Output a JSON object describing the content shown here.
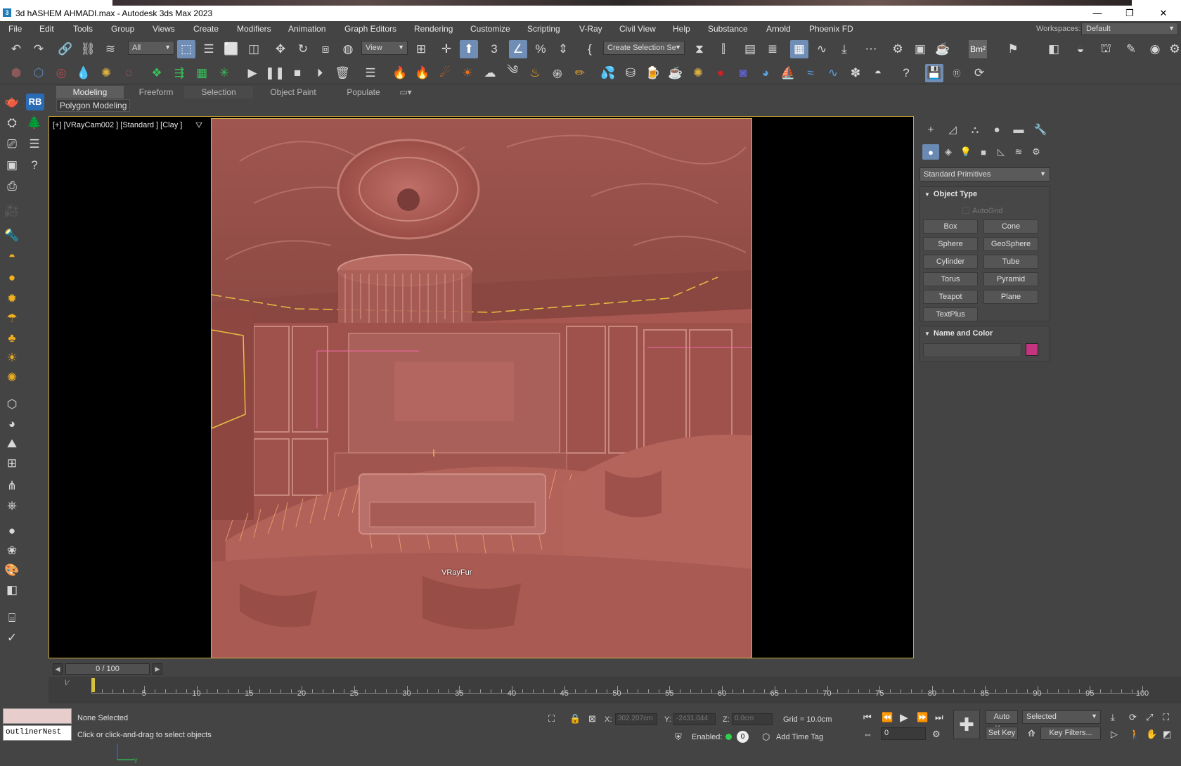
{
  "window": {
    "title": "3d hASHEM AHMADI.max - Autodesk 3ds Max 2023",
    "app_icon": "3",
    "controls": [
      "—",
      "❐",
      "✕"
    ]
  },
  "menu": [
    "File",
    "Edit",
    "Tools",
    "Group",
    "Views",
    "Create",
    "Modifiers",
    "Animation",
    "Graph Editors",
    "Rendering",
    "Customize",
    "Scripting",
    "V-Ray",
    "Civil View",
    "Help",
    "Substance",
    "Arnold",
    "Phoenix FD"
  ],
  "workspaces": {
    "label": "Workspaces:",
    "value": "Default"
  },
  "toolbar": {
    "selection_filter": "All",
    "ref_coord": "View",
    "create_selection_set": "Create Selection Se",
    "snaps_label": "3",
    "bm_label": "Bm²"
  },
  "ribbon": {
    "tabs": [
      "Modeling",
      "Freeform",
      "Selection",
      "Object Paint",
      "Populate"
    ],
    "active_tab": "Modeling",
    "sub_label": "Polygon Modeling"
  },
  "left_badge": "RB",
  "viewport": {
    "label": "[+] [VRayCam002 ] [Standard ] [Clay ]",
    "object_label": "VRayFur",
    "axis_z": "z",
    "axis_y": "y"
  },
  "command_panel": {
    "category_dropdown": "Standard Primitives",
    "object_type": {
      "header": "Object Type",
      "autogrid": "AutoGrid",
      "buttons": [
        "Box",
        "Cone",
        "Sphere",
        "GeoSphere",
        "Cylinder",
        "Tube",
        "Torus",
        "Pyramid",
        "Teapot",
        "Plane",
        "TextPlus"
      ]
    },
    "name_and_color": {
      "header": "Name and Color",
      "name_value": "",
      "color": "#c4347f"
    }
  },
  "timeline": {
    "slider_text": "0 / 100",
    "ticks": [
      0,
      5,
      10,
      15,
      20,
      25,
      30,
      35,
      40,
      45,
      50,
      55,
      60,
      65,
      70,
      75,
      80,
      85,
      90,
      95,
      100
    ],
    "current_frame_fraction": 0.0
  },
  "status": {
    "maxscript_input": "outlinerNest",
    "selection": "None Selected",
    "prompt": "Click or click-and-drag to select objects",
    "x_label": "X:",
    "x_value": "302.207cm",
    "y_label": "Y:",
    "y_value": "-2431.044",
    "z_label": "Z:",
    "z_value": "0.0cm",
    "grid": "Grid = 10.0cm",
    "enabled": "Enabled:",
    "enabled_value": "0",
    "add_time_tag": "Add Time Tag",
    "auto_key": "Auto Key",
    "set_key": "Set Key",
    "selected_drop": "Selected",
    "key_filters": "Key Filters...",
    "frame_value": "0"
  }
}
